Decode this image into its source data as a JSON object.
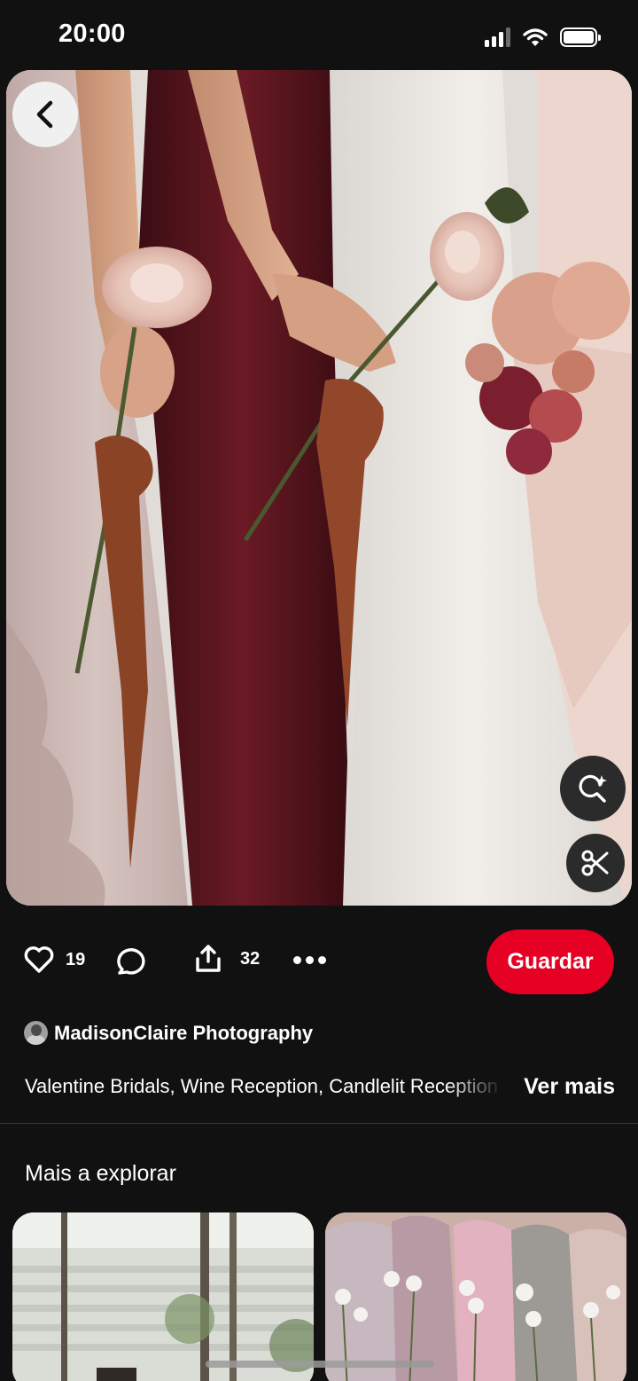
{
  "status_bar": {
    "time": "20:00",
    "icons": [
      "cellular-signal-icon",
      "wifi-icon",
      "battery-icon"
    ]
  },
  "pin": {
    "image_alt": "Bridesmaids in blush and wine dresses holding single roses with rust ribbons beside bride",
    "likes": "19",
    "shares": "32",
    "save_label": "Guardar",
    "author_name": "MadisonClaire Photography",
    "description": "Valentine Bridals, Wine Reception, Candlelit Reception",
    "see_more_label": "Ver mais"
  },
  "explore": {
    "title": "Mais a explorar"
  },
  "colors": {
    "background": "#111111",
    "save_button": "#e60023",
    "text": "#ffffff"
  }
}
